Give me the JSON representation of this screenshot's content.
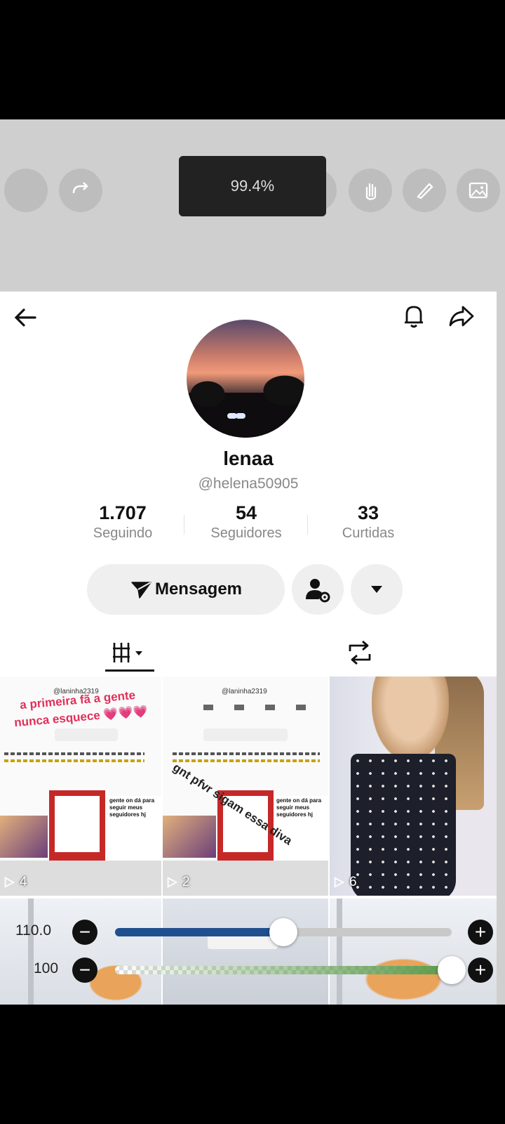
{
  "editor": {
    "zoom_label": "99.4%",
    "tools": [
      "circle-tool-icon",
      "redo-icon",
      "select-icon",
      "hand-icon",
      "brush-icon",
      "image-icon"
    ]
  },
  "profile": {
    "display_name": "lenaa",
    "username": "@helena50905",
    "stats": [
      {
        "value": "1.707",
        "label": "Seguindo"
      },
      {
        "value": "54",
        "label": "Seguidores"
      },
      {
        "value": "33",
        "label": "Curtidas"
      }
    ],
    "message_button": "Mensagem"
  },
  "grid": {
    "videos": [
      {
        "play_count": "4",
        "overlay_text_1": "a primeira fã a gente",
        "overlay_text_2": "nunca esquece 💗💗💗",
        "mini_handle": "@laninha2319"
      },
      {
        "play_count": "2",
        "overlay_text": "gnt pfvr sigam essa diva",
        "mini_handle": "@laninha2319"
      },
      {
        "play_count": "6"
      }
    ]
  },
  "sliders": [
    {
      "value_label": "110.0",
      "fraction": 0.5,
      "color": "#1f4f8f"
    },
    {
      "value_label": "100",
      "fraction": 1.0,
      "color": "#5a9a4a"
    }
  ]
}
